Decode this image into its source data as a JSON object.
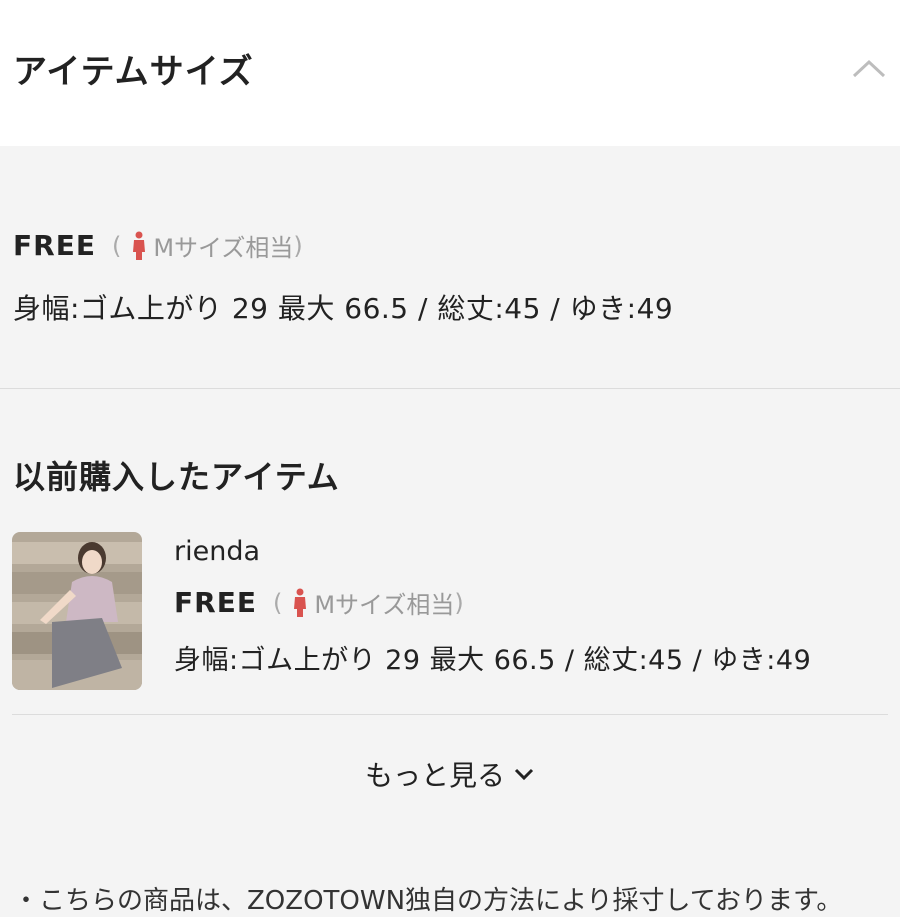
{
  "header": {
    "title": "アイテムサイズ",
    "collapse_icon": "chevron-up-icon"
  },
  "size": {
    "name": "FREE",
    "paren_open": "(",
    "equivalent": "Mサイズ相当",
    "paren_close": ")",
    "icon": "female-person-icon",
    "icon_color": "#d9534f",
    "measurements": "身幅:ゴム上がり 29 最大 66.5 / 総丈:45 / ゆき:49"
  },
  "previous": {
    "title": "以前購入したアイテム",
    "items": [
      {
        "brand": "rienda",
        "size_name": "FREE",
        "paren_open": "(",
        "equivalent": "Mサイズ相当",
        "paren_close": ")",
        "measurements": "身幅:ゴム上がり 29 最大 66.5 / 総丈:45 / ゆき:49",
        "thumbnail": "product-photo"
      }
    ]
  },
  "more": {
    "label": "もっと見る",
    "icon": "chevron-down-icon"
  },
  "note": {
    "text": "・こちらの商品は、ZOZOTOWN独自の方法により採寸しております。"
  },
  "colors": {
    "header_bg": "#ffffff",
    "body_bg": "#f4f4f4",
    "text": "#222222",
    "muted": "#999999"
  }
}
